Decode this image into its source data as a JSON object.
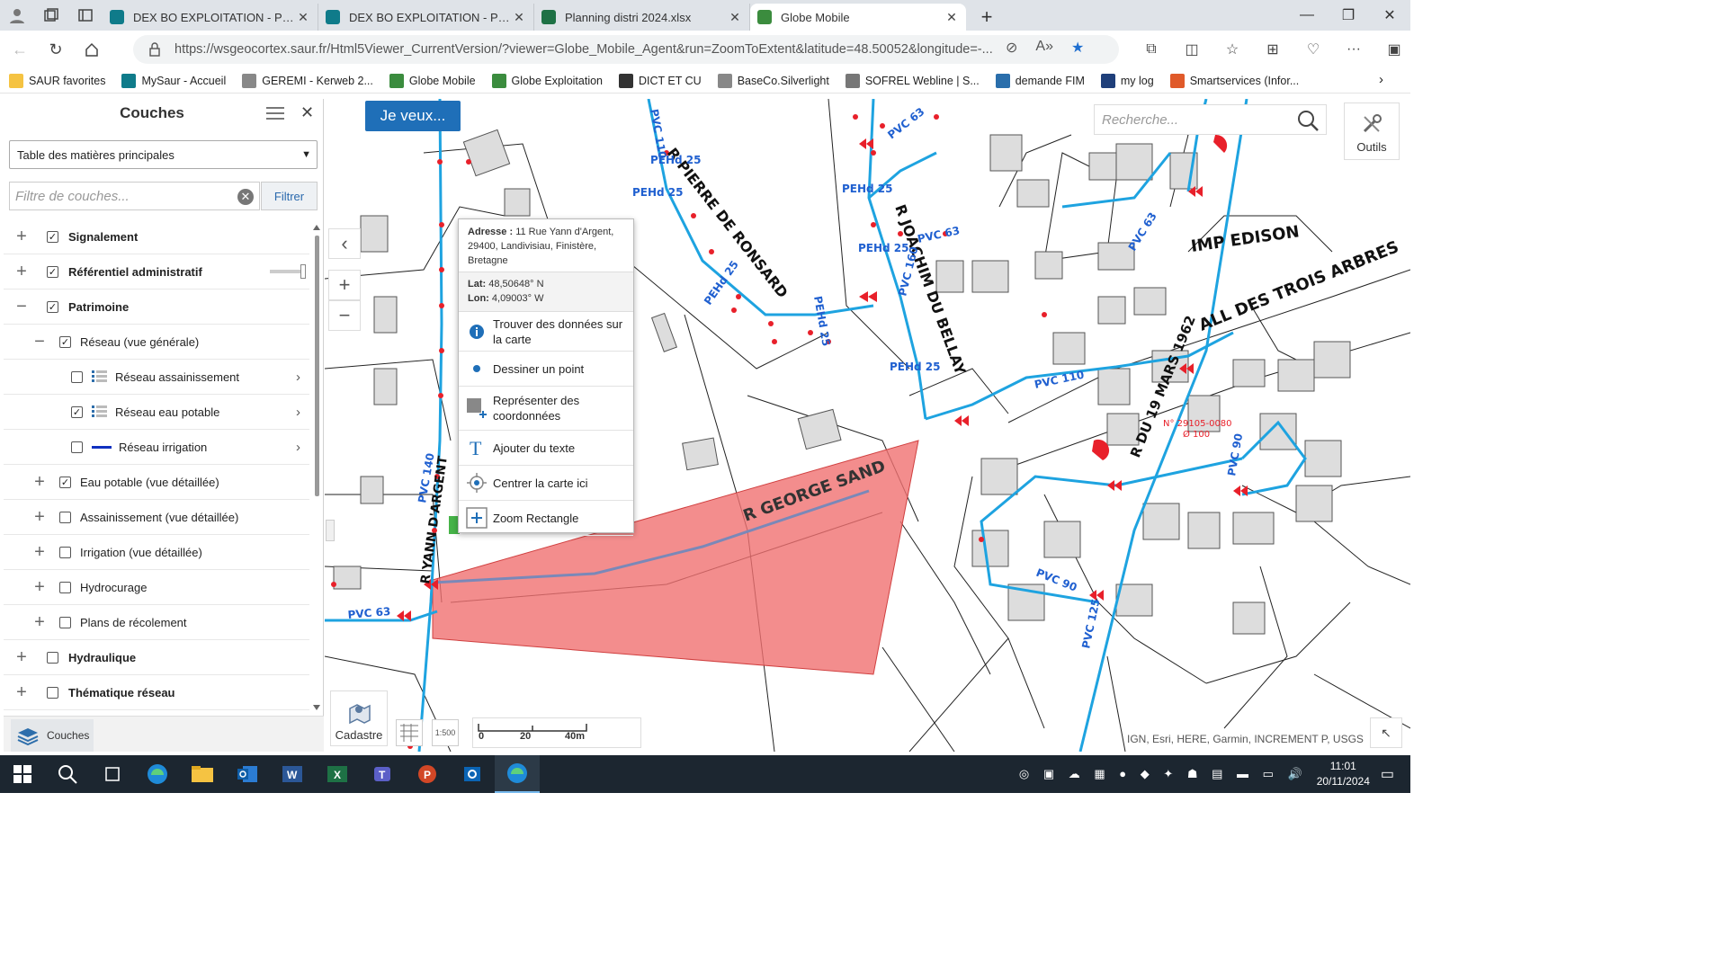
{
  "browser": {
    "tabs": [
      {
        "title": "DEX BO EXPLOITATION - Planning",
        "icon": "sharepoint-icon",
        "active": false
      },
      {
        "title": "DEX BO EXPLOITATION - Planning",
        "icon": "sharepoint-icon",
        "active": false
      },
      {
        "title": "Planning distri 2024.xlsx",
        "icon": "excel-icon",
        "active": false
      },
      {
        "title": "Globe Mobile",
        "icon": "globe-mobile-icon",
        "active": true
      }
    ],
    "url": "https://wsgeocortex.saur.fr/Html5Viewer_CurrentVersion/?viewer=Globe_Mobile_Agent&run=ZoomToExtent&latitude=48.50052&longitude=-...",
    "favorites": [
      "SAUR favorites",
      "MySaur - Accueil",
      "GEREMI - Kerweb 2...",
      "Globe Mobile",
      "Globe Exploitation",
      "DICT ET CU",
      "BaseCo.Silverlight",
      "SOFREL Webline | S...",
      "demande FIM",
      "my log",
      "Smartservices (Infor..."
    ]
  },
  "panel": {
    "title": "Couches",
    "toc_select": "Table des matières principales",
    "filter_placeholder": "Filtre de couches...",
    "filter_button": "Filtrer",
    "layers": [
      {
        "label": "Signalement",
        "level": 0,
        "expand": "+",
        "checked": true,
        "bold": true
      },
      {
        "label": "Référentiel administratif",
        "level": 0,
        "expand": "+",
        "checked": true,
        "bold": true,
        "slider": true
      },
      {
        "label": "Patrimoine",
        "level": 0,
        "expand": "−",
        "checked": true,
        "bold": true
      },
      {
        "label": "Réseau (vue générale)",
        "level": 1,
        "expand": "−",
        "checked": true
      },
      {
        "label": "Réseau assainissement",
        "level": 2,
        "checked": false,
        "legend": "list",
        "chevron": true
      },
      {
        "label": "Réseau eau potable",
        "level": 2,
        "checked": true,
        "legend": "list",
        "chevron": true
      },
      {
        "label": "Réseau irrigation",
        "level": 2,
        "checked": false,
        "legend": "line",
        "chevron": true
      },
      {
        "label": "Eau potable (vue détaillée)",
        "level": 1,
        "expand": "+",
        "checked": true
      },
      {
        "label": "Assainissement (vue détaillée)",
        "level": 1,
        "expand": "+",
        "checked": false
      },
      {
        "label": "Irrigation (vue détaillée)",
        "level": 1,
        "expand": "+",
        "checked": false
      },
      {
        "label": "Hydrocurage",
        "level": 1,
        "expand": "+",
        "checked": false
      },
      {
        "label": "Plans de récolement",
        "level": 1,
        "expand": "+",
        "checked": false
      },
      {
        "label": "Hydraulique",
        "level": 0,
        "expand": "+",
        "checked": false,
        "bold": true
      },
      {
        "label": "Thématique réseau",
        "level": 0,
        "expand": "+",
        "checked": false,
        "bold": true
      }
    ],
    "footer_button": "Couches"
  },
  "map": {
    "je_veux": "Je veux...",
    "search_placeholder": "Recherche...",
    "outils": "Outils",
    "cadastre": "Cadastre",
    "scale_labels": [
      "0",
      "20",
      "40m"
    ],
    "scale_badge": "1:500",
    "attribution": "IGN, Esri, HERE, Garmin, INCREMENT P, USGS",
    "labels": {
      "imp_edison": "IMP EDISON",
      "all_trois_arbres": "ALL DES TROIS ARBRES",
      "r_george_sand": "R GEORGE SAND",
      "r_pierre_de_ronsard": "R PIERRE DE RONSARD",
      "r_joachim_du_bellay": "R JOACHIM DU BELLAY",
      "r_19_mars_1962": "R DU 19 MARS 1962",
      "r_yann_argent": "R YANN D'ARGENT",
      "pvc110": "PVC 110",
      "pvc110b": "PVC 110",
      "pvc90": "PVC 90",
      "pvc90b": "PVC 90",
      "pvc125": "PVC 125",
      "pvc63a": "PVC 63",
      "pvc63b": "PVC 63",
      "pvc63c": "PVC 63",
      "pvc63d": "PVC 63",
      "pvc160": "PVC 160",
      "pvc140": "PVC 140",
      "pehd25": "PEHd 25",
      "annot1": "N° 29105-0080",
      "annot2": "Ø 100"
    },
    "popup": {
      "addr_label": "Adresse :",
      "addr_value": "11 Rue Yann d'Argent, 29400, Landivisiau, Finistère, Bretagne",
      "lat_label": "Lat:",
      "lat_value": "48,50648° N",
      "lon_label": "Lon:",
      "lon_value": "4,09003° W",
      "items": [
        {
          "label": "Trouver des données sur la carte",
          "icon": "info-icon"
        },
        {
          "label": "Dessiner un point",
          "icon": "point-icon"
        },
        {
          "label": "Représenter des coordonnées",
          "icon": "coordinates-icon"
        },
        {
          "label": "Ajouter du texte",
          "icon": "text-icon"
        },
        {
          "label": "Centrer la carte ici",
          "icon": "center-icon"
        },
        {
          "label": "Zoom Rectangle",
          "icon": "zoom-rectangle-icon"
        }
      ]
    },
    "colors": {
      "pipe": "#1ea3e0",
      "node": "#e8202a",
      "polygon": "#f07070",
      "accent": "#1f6fb8"
    }
  },
  "taskbar": {
    "time": "11:01",
    "date": "20/11/2024"
  }
}
